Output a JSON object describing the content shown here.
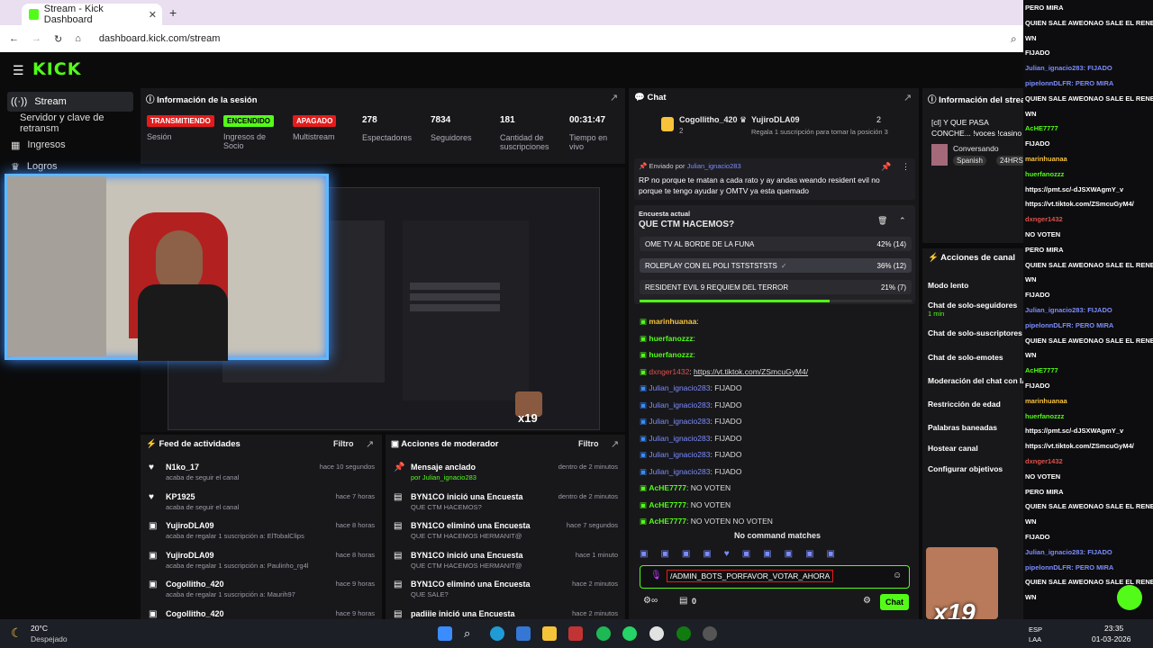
{
  "browser": {
    "tab_title": "Stream - Kick Dashboard",
    "url": "dashboard.kick.com/stream"
  },
  "nav": {
    "logo": "KICK",
    "items": [
      "Stream",
      "Servidor y clave de retransm",
      "Ingresos",
      "Logros"
    ]
  },
  "session": {
    "title": "Información de la sesión",
    "stats": [
      {
        "badge": "TRANSMITIENDO",
        "label": "Sesión",
        "color": "#e51b1b"
      },
      {
        "badge": "ENCENDIDO",
        "label": "Ingresos de Socio",
        "color": "#53fc18"
      },
      {
        "badge": "APAGADO",
        "label": "Multistream",
        "color": "#e51b1b"
      },
      {
        "value": "278",
        "label": "Espectadores"
      },
      {
        "value": "7834",
        "label": "Seguidores"
      },
      {
        "value": "181",
        "label": "Cantidad de suscripciones"
      },
      {
        "value": "00:31:47",
        "label": "Tiempo en vivo"
      }
    ]
  },
  "feed": {
    "title": "Feed de actividades",
    "filter": "Filtro",
    "rows": [
      {
        "name": "N1ko_17",
        "sub": "acaba de seguir el canal",
        "time": "hace 10 segundos"
      },
      {
        "name": "KP1925",
        "sub": "acaba de seguir el canal",
        "time": "hace 7 horas"
      },
      {
        "name": "YujiroDLA09",
        "sub": "acaba de regalar 1 suscripción a: ElTobalClips",
        "time": "hace 8 horas"
      },
      {
        "name": "YujiroDLA09",
        "sub": "acaba de regalar 1 suscripción a: Paulinho_rg4l",
        "time": "hace 8 horas"
      },
      {
        "name": "Cogollitho_420",
        "sub": "acaba de regalar 1 suscripción a: Maurih97",
        "time": "hace 9 horas"
      },
      {
        "name": "Cogollitho_420",
        "sub": "",
        "time": "hace 9 horas"
      }
    ]
  },
  "mod": {
    "title": "Acciones de moderador",
    "filter": "Filtro",
    "rows": [
      {
        "name": "Mensaje anclado",
        "sub": "por Julian_ignacio283",
        "time": "dentro de 2 minutos"
      },
      {
        "name": "BYN1CO inició una Encuesta",
        "sub": "QUE CTM HACEMOS?",
        "time": "dentro de 2 minutos"
      },
      {
        "name": "BYN1CO eliminó una Encuesta",
        "sub": "QUE CTM HACEMOS HERMANIT@",
        "time": "hace 7 segundos"
      },
      {
        "name": "BYN1CO inició una Encuesta",
        "sub": "QUE CTM HACEMOS HERMANIT@",
        "time": "hace 1 minuto"
      },
      {
        "name": "BYN1CO eliminó una Encuesta",
        "sub": "QUE SALE?",
        "time": "hace 2 minutos"
      },
      {
        "name": "padiiie inició una Encuesta",
        "sub": "",
        "time": "hace 2 minutos"
      }
    ]
  },
  "chat": {
    "title": "Chat",
    "top": {
      "user1": "Cogollitho_420",
      "user1_count": "2",
      "user2": "YujiroDLA09",
      "user2_count": "2",
      "gift": "Regala 1 suscripción para tomar la posición 3"
    },
    "pinned_by": "Enviado por",
    "pinned_user": "Julian_ignacio283",
    "pinned_text": "RP no porque te matan a cada rato y ay andas weando resident evil no porque te tengo ayudar y OMTV ya esta quemado",
    "poll": {
      "label": "Encuesta actual",
      "question": "QUE CTM HACEMOS?",
      "options": [
        {
          "text": "OME TV AL BORDE DE LA FUNA",
          "pct": "42% (14)",
          "value": 42
        },
        {
          "text": "ROLEPLAY CON EL POLI TSTSTSTSTS",
          "pct": "36% (12)",
          "value": 36
        },
        {
          "text": "RESIDENT EVIL 9 REQUIEM DEL TERROR",
          "pct": "21% (7)",
          "value": 21
        }
      ]
    },
    "messages": [
      {
        "user": "marinhuanaa",
        "text": ""
      },
      {
        "user": "huerfanozzz",
        "text": ""
      },
      {
        "user": "huerfanozzz",
        "text": ""
      },
      {
        "user": "dxnger1432",
        "text": "https://vt.tiktok.com/ZSmcuGyM4/"
      },
      {
        "user": "Julian_ignacio283",
        "text": "FIJADO"
      },
      {
        "user": "Julian_ignacio283",
        "text": "FIJADO"
      },
      {
        "user": "Julian_ignacio283",
        "text": "FIJADO"
      },
      {
        "user": "Julian_ignacio283",
        "text": "FIJADO"
      },
      {
        "user": "Julian_ignacio283",
        "text": "FIJADO"
      },
      {
        "user": "Julian_ignacio283",
        "text": "FIJADO"
      },
      {
        "user": "AcHE7777",
        "text": "NO VOTEN"
      },
      {
        "user": "AcHE7777",
        "text": "NO VOTEN"
      },
      {
        "user": "AcHE7777",
        "text": "NO VOTEN NO VOTEN"
      }
    ],
    "no_match": "No command matches",
    "input_value": "/ADMIN_BOTS_PORFAVOR_VOTAR_AHORA",
    "count": "0",
    "send": "Chat"
  },
  "stream_info": {
    "title": "Información del stream",
    "text": "[cl] Y QUE PASA CONCHE... !voces !casino",
    "category": "Conversando",
    "tags": [
      "Spanish",
      "24HRS",
      "BYN1CO",
      "Chile"
    ]
  },
  "actions": {
    "title": "Acciones de canal",
    "items": [
      "Modo lento",
      "Chat de solo-seguidores",
      "Chat de solo-suscriptores",
      "Chat de solo-emotes",
      "Moderación del chat con IA",
      "Restricción de edad",
      "Palabras baneadas",
      "Hostear canal",
      "Configurar objetivos"
    ],
    "followers_sub": "1 min"
  },
  "overlay": {
    "lines": [
      "PERO MIRA",
      "QUIEN SALE AWEONAO SALE EL RENE",
      "WN",
      "FIJADO",
      "Julian_ignacio283: FIJADO",
      "pipelonnDLFR: PERO MIRA",
      "QUIEN SALE AWEONAO SALE EL RENE",
      "WN",
      "AcHE7777",
      "FIJADO",
      "marinhuanaa",
      "huerfanozzz",
      "https://pmt.sc/-dJSXWAgmY_v",
      "https://vt.tiktok.com/ZSmcuGyM4/",
      "dxnger1432",
      "NO VOTEN",
      "x19"
    ]
  },
  "weather": {
    "temp": "20°C",
    "desc": "Despejado"
  },
  "clock": {
    "time": "23:35",
    "date": "01-03-2026",
    "lang": "ESP",
    "region": "LAA"
  }
}
